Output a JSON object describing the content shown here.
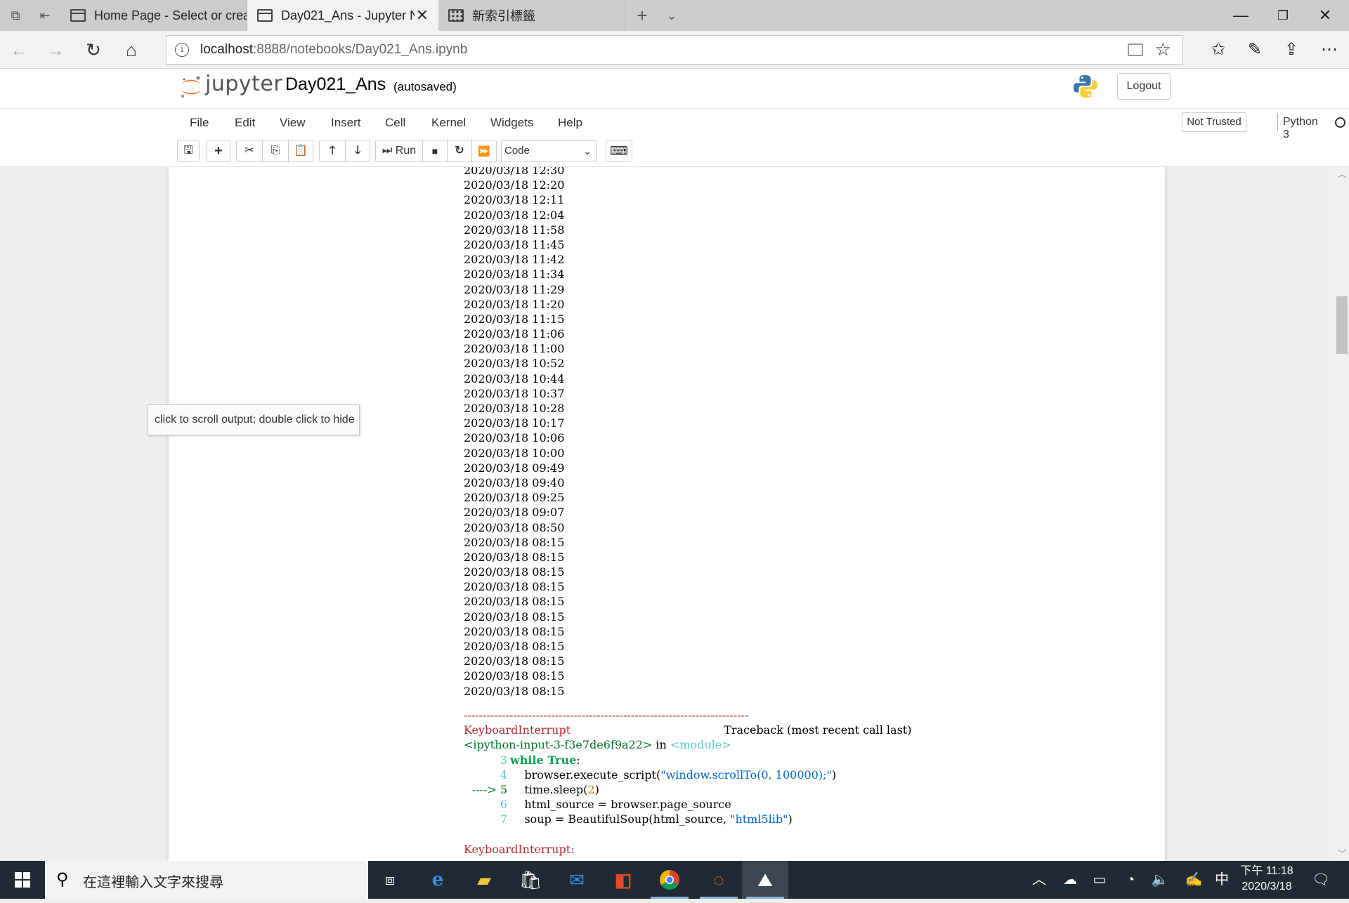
{
  "browser": {
    "tabs": [
      {
        "title": "Home Page - Select or creat"
      },
      {
        "title": "Day021_Ans - Jupyter N"
      },
      {
        "title": "新索引標籤"
      }
    ],
    "address": {
      "host": "localhost",
      "path": ":8888/notebooks/Day021_Ans.ipynb"
    }
  },
  "jupyter": {
    "logo_text": "jupyter",
    "notebook_name": "Day021_Ans",
    "save_status": "(autosaved)",
    "logout_label": "Logout",
    "menu": [
      "File",
      "Edit",
      "View",
      "Insert",
      "Cell",
      "Kernel",
      "Widgets",
      "Help"
    ],
    "trust_label": "Not Trusted",
    "kernel_name": "Python 3",
    "toolbar": {
      "run_label": "Run",
      "cell_type": "Code"
    }
  },
  "output": {
    "lines": [
      "2020/03/18 12:30",
      "2020/03/18 12:20",
      "2020/03/18 12:11",
      "2020/03/18 12:04",
      "2020/03/18 11:58",
      "2020/03/18 11:45",
      "2020/03/18 11:42",
      "2020/03/18 11:34",
      "2020/03/18 11:29",
      "2020/03/18 11:20",
      "2020/03/18 11:15",
      "2020/03/18 11:06",
      "2020/03/18 11:00",
      "2020/03/18 10:52",
      "2020/03/18 10:44",
      "2020/03/18 10:37",
      "2020/03/18 10:28",
      "2020/03/18 10:17",
      "2020/03/18 10:06",
      "2020/03/18 10:00",
      "2020/03/18 09:49",
      "2020/03/18 09:40",
      "2020/03/18 09:25",
      "2020/03/18 09:07",
      "2020/03/18 08:50",
      "2020/03/18 08:15",
      "2020/03/18 08:15",
      "2020/03/18 08:15",
      "2020/03/18 08:15",
      "2020/03/18 08:15",
      "2020/03/18 08:15",
      "2020/03/18 08:15",
      "2020/03/18 08:15",
      "2020/03/18 08:15",
      "2020/03/18 08:15",
      "2020/03/18 08:15"
    ],
    "tooltip": "click to scroll output; double click to hide"
  },
  "traceback": {
    "separator": "---------------------------------------------------------------------------",
    "error_name": "KeyboardInterrupt",
    "header_right": "Traceback (most recent call last)",
    "input_ref": "<ipython-input-3-f3e7de6f9a22>",
    "in_word": " in ",
    "module": "<module>",
    "lines": [
      {
        "num": "3",
        "code_kw": "while True",
        "code_rest": ":"
      },
      {
        "num": "4",
        "code": "    browser.execute_script(",
        "str": "\"window.scrollTo(0, 100000);\"",
        "tail": ")"
      },
      {
        "num": "----> 5",
        "code": "    time.sleep(",
        "n": "2",
        "tail": ")"
      },
      {
        "num": "6",
        "code": "    html_source = browser.page_source"
      },
      {
        "num": "7",
        "code": "    soup = BeautifulSoup(html_source, ",
        "str": "\"html5lib\"",
        "tail": ")"
      }
    ],
    "final": "KeyboardInterrupt:"
  },
  "taskbar": {
    "search_placeholder": "在這裡輸入文字來搜尋",
    "ime": "中",
    "clock_time": "下午 11:18",
    "clock_date": "2020/3/18"
  }
}
